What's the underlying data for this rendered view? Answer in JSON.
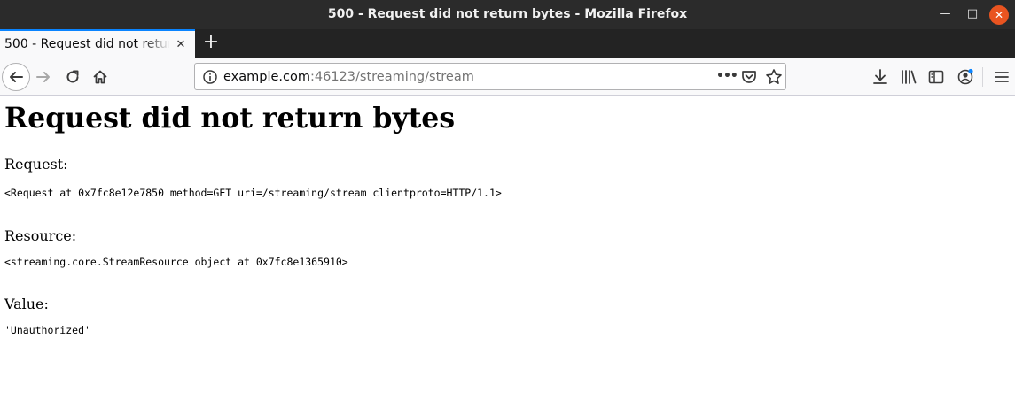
{
  "window": {
    "title": "500 - Request did not return bytes - Mozilla Firefox",
    "minimize_icon": "minimize-icon",
    "maximize_icon": "maximize-icon",
    "close_icon": "close-icon"
  },
  "tabs": [
    {
      "title": "500 - Request did not return bytes",
      "active": true
    }
  ],
  "toolbar": {
    "url_host": "example.com",
    "url_rest": ":46123/streaming/stream",
    "page_actions_label": "•••",
    "icons": [
      "back-arrow-icon",
      "forward-arrow-icon",
      "reload-icon",
      "home-icon",
      "info-icon",
      "pocket-icon",
      "star-icon",
      "download-icon",
      "library-icon",
      "sidebar-icon",
      "account-icon",
      "hamburger-menu-icon"
    ],
    "accent": "#0a84ff"
  },
  "page": {
    "heading": "Request did not return bytes",
    "request_label": "Request:",
    "request_value": "<Request at 0x7fc8e12e7850 method=GET uri=/streaming/stream clientproto=HTTP/1.1>",
    "resource_label": "Resource:",
    "resource_value": "<streaming.core.StreamResource object at 0x7fc8e1365910>",
    "value_label": "Value:",
    "value_value": "'Unauthorized'"
  }
}
